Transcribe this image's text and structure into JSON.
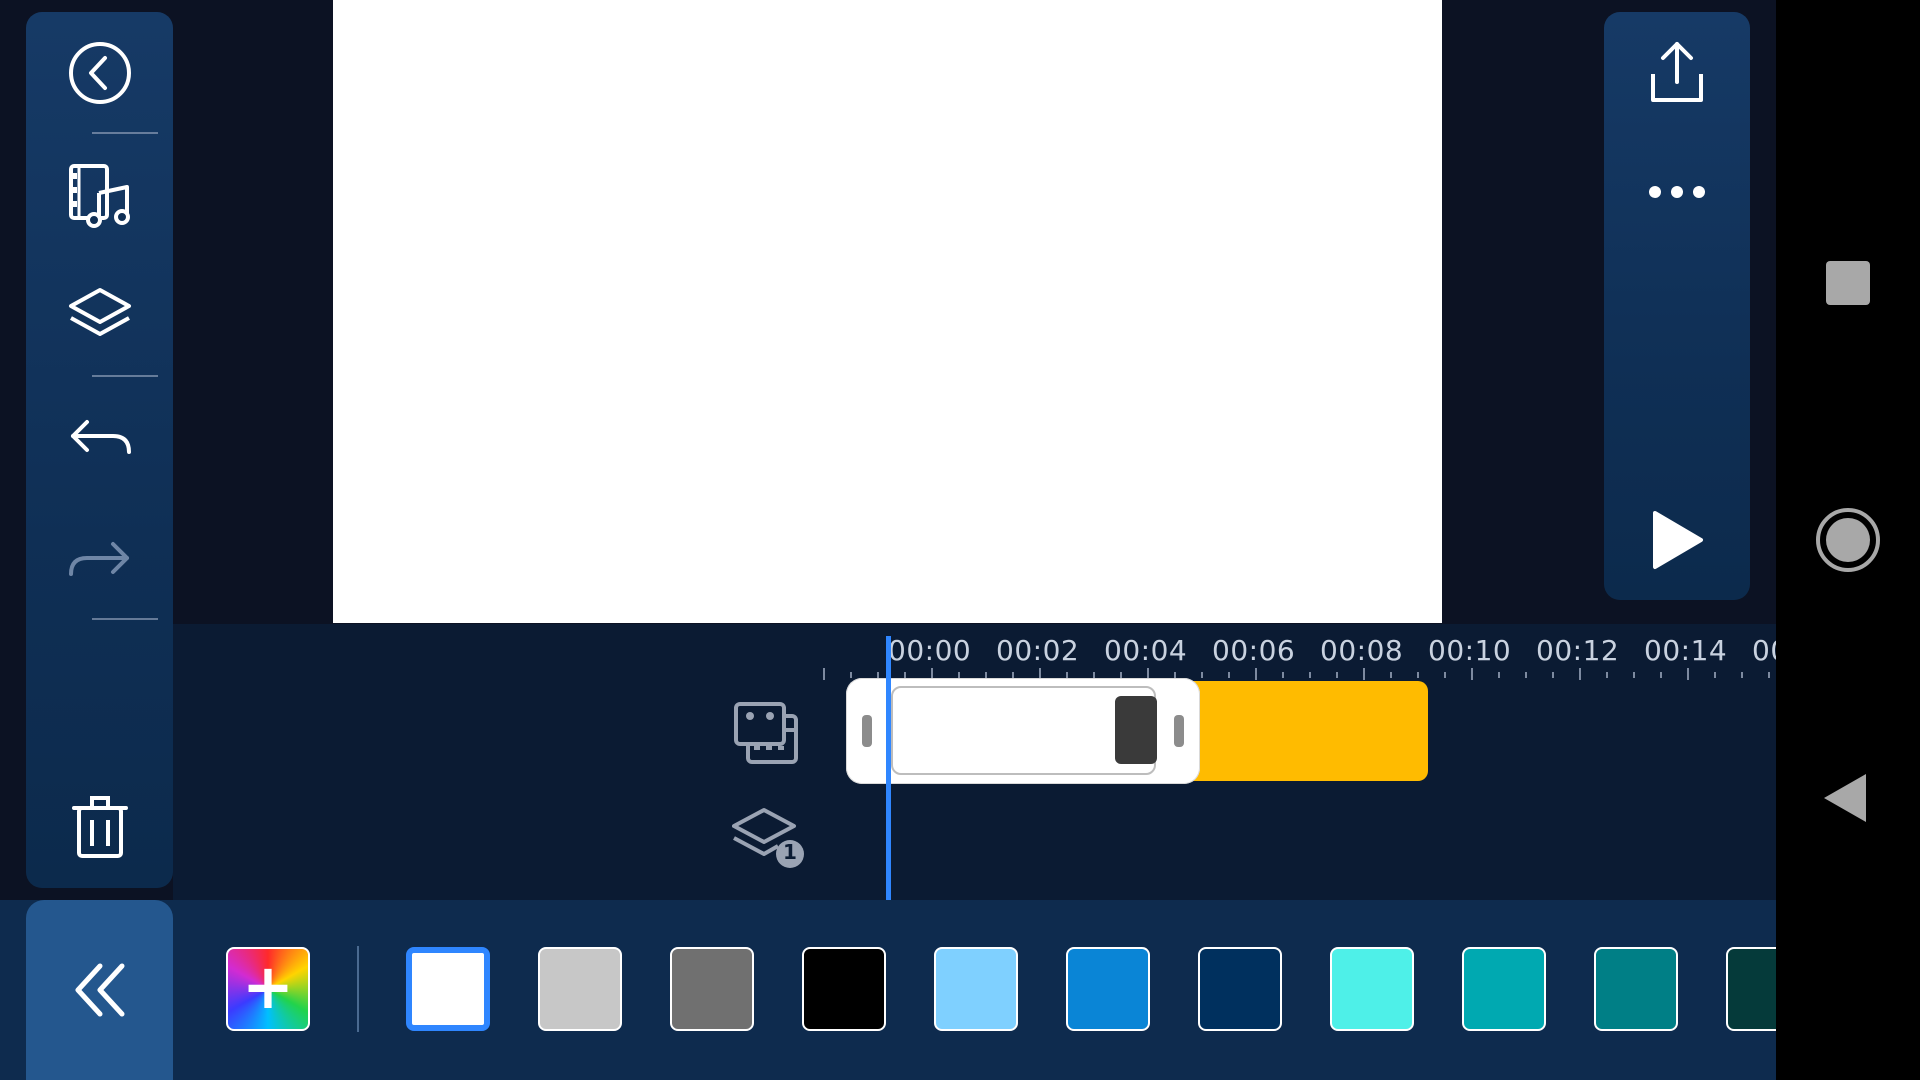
{
  "toolbar_left": {
    "icons": [
      "back-circle-icon",
      "media-music-icon",
      "layers-icon",
      "undo-icon",
      "redo-icon",
      "trash-icon"
    ]
  },
  "toolbar_right": {
    "icons": [
      "share-upload-icon",
      "more-dots-icon",
      "play-icon"
    ]
  },
  "timeline": {
    "ticks": [
      "00:00",
      "00:02",
      "00:04",
      "00:06",
      "00:08",
      "00:10",
      "00:12",
      "00:14",
      "00"
    ],
    "layer_count_badge": "1"
  },
  "palette": {
    "add_label": "+",
    "colors": [
      "#ffffff",
      "#c7c7c7",
      "#707070",
      "#000000",
      "#7fd0ff",
      "#0a85d6",
      "#00305e",
      "#4ef0e8",
      "#00a9b1",
      "#007f86",
      "#053a3a"
    ],
    "selected_index": 0
  },
  "colors": {
    "panel": "#0f2f55",
    "accent": "#2f86ff",
    "clip_yellow": "#ffbb00"
  }
}
